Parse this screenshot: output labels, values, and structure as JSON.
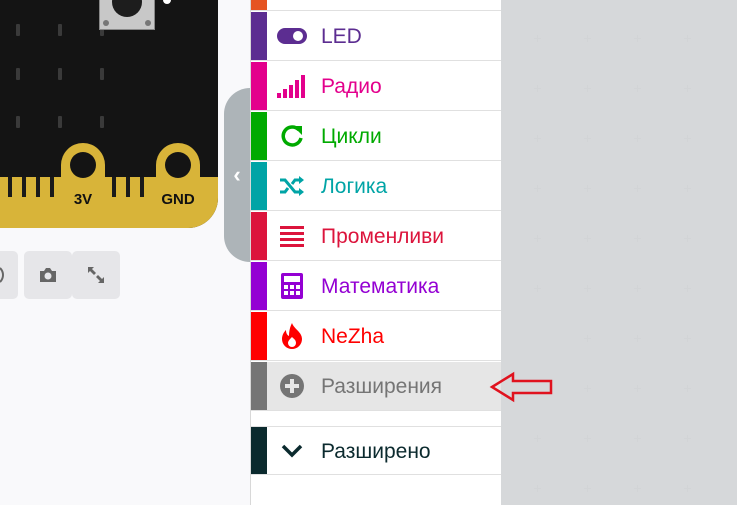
{
  "simulator": {
    "pin_labels": [
      "3V",
      "GND"
    ],
    "buttons": [
      {
        "name": "audio-button",
        "icon": "speaker-icon"
      },
      {
        "name": "screenshot-button",
        "icon": "camera-icon"
      },
      {
        "name": "fullscreen-button",
        "icon": "expand-icon"
      }
    ]
  },
  "toolbox": {
    "categories": [
      {
        "key": "led",
        "label": "LED",
        "color": "#5c2d91",
        "icon": "toggle-icon"
      },
      {
        "key": "radio",
        "label": "Радио",
        "color": "#e3008c",
        "icon": "signal-bars-icon"
      },
      {
        "key": "loops",
        "label": "Цикли",
        "color": "#00aa00",
        "icon": "refresh-icon"
      },
      {
        "key": "logic",
        "label": "Логика",
        "color": "#00a4a6",
        "icon": "shuffle-icon"
      },
      {
        "key": "variables",
        "label": "Променливи",
        "color": "#dc143c",
        "icon": "list-icon"
      },
      {
        "key": "math",
        "label": "Математика",
        "color": "#9400d3",
        "icon": "calculator-icon"
      },
      {
        "key": "nezha",
        "label": "NeZha",
        "color": "#ff0000",
        "icon": "flame-icon"
      },
      {
        "key": "extensions",
        "label": "Разширения",
        "color": "#757575",
        "icon": "plus-circle-icon"
      },
      {
        "key": "advanced",
        "label": "Разширено",
        "color": "#0b2a2e",
        "icon": "chevron-down-icon"
      }
    ]
  },
  "annotation": {
    "arrow_color": "#e0121e"
  }
}
